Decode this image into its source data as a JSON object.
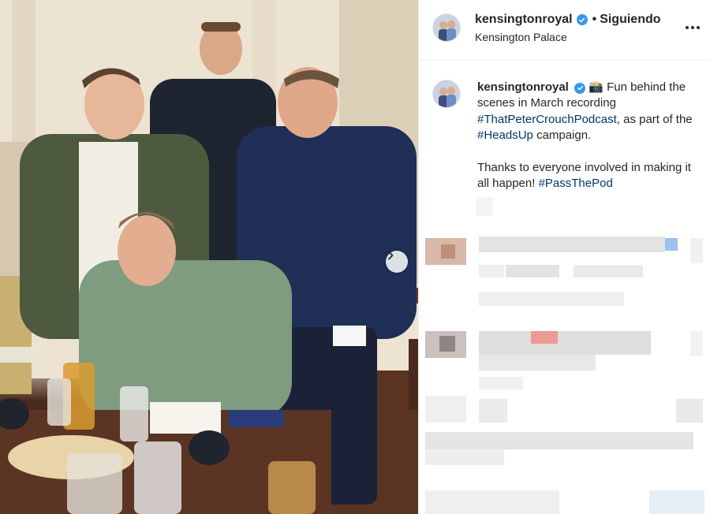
{
  "post": {
    "username": "kensingtonroyal",
    "follow_status": "Siguiendo",
    "location": "Kensington Palace",
    "caption": {
      "camera_emoji": "📸",
      "intro": "Fun behind the scenes in March recording",
      "hashtag_podcast": "#ThatPeterCrouchPodcast",
      "middle": ", as part of the",
      "hashtag_campaign": "#HeadsUp",
      "after_campaign": "campaign.",
      "thanks": "Thanks to everyone involved in making it all happen!",
      "hashtag_pass": "#PassThePod"
    }
  },
  "icons": {
    "verified": "verified-badge-icon",
    "more": "more-options-icon",
    "next": "chevron-right-icon"
  },
  "colors": {
    "verified_blue": "#3897f0",
    "hashtag": "#00376b",
    "text": "#262626",
    "divider": "#efefef"
  }
}
